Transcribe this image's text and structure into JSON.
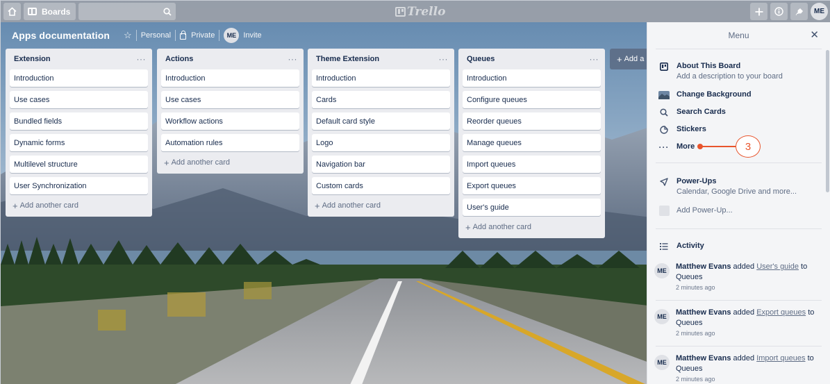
{
  "topbar": {
    "boards_label": "Boards",
    "logo_text": "Trello",
    "avatar_initials": "ME"
  },
  "board": {
    "title": "Apps documentation",
    "visibility_team": "Personal",
    "visibility_privacy": "Private",
    "member_initials": "ME",
    "invite_label": "Invite"
  },
  "lists": [
    {
      "title": "Extension",
      "cards": [
        "Introduction",
        "Use cases",
        "Bundled fields",
        "Dynamic forms",
        "Multilevel structure",
        "User Synchronization"
      ],
      "add_card_label": "Add another card"
    },
    {
      "title": "Actions",
      "cards": [
        "Introduction",
        "Use cases",
        "Workflow actions",
        "Automation rules"
      ],
      "add_card_label": "Add another card"
    },
    {
      "title": "Theme Extension",
      "cards": [
        "Introduction",
        "Cards",
        "Default card style",
        "Logo",
        "Navigation bar",
        "Custom cards"
      ],
      "add_card_label": "Add another card"
    },
    {
      "title": "Queues",
      "cards": [
        "Introduction",
        "Configure queues",
        "Reorder queues",
        "Manage queues",
        "Import queues",
        "Export queues",
        "User's guide"
      ],
      "add_card_label": "Add another card"
    }
  ],
  "add_list_label": "Add a",
  "menu": {
    "title": "Menu",
    "about_label": "About This Board",
    "about_sub": "Add a description to your board",
    "change_bg_label": "Change Background",
    "search_cards_label": "Search Cards",
    "stickers_label": "Stickers",
    "more_label": "More",
    "powerups_label": "Power-Ups",
    "powerups_sub": "Calendar, Google Drive and more...",
    "add_powerup_label": "Add Power-Up...",
    "activity_label": "Activity",
    "activity": [
      {
        "initials": "ME",
        "user": "Matthew Evans",
        "verb": "added",
        "card": "User's guide",
        "prep": "to",
        "list": "Queues",
        "time": "2 minutes ago"
      },
      {
        "initials": "ME",
        "user": "Matthew Evans",
        "verb": "added",
        "card": "Export queues",
        "prep": "to",
        "list": "Queues",
        "time": "2 minutes ago"
      },
      {
        "initials": "ME",
        "user": "Matthew Evans",
        "verb": "added",
        "card": "Import queues",
        "prep": "to",
        "list": "Queues",
        "time": "2 minutes ago"
      }
    ]
  },
  "annotation": {
    "step_number": "3",
    "color": "#e8552d"
  },
  "colors": {
    "list_bg": "#ebecf0",
    "menu_bg": "#f4f5f7",
    "text": "#172b4d"
  }
}
